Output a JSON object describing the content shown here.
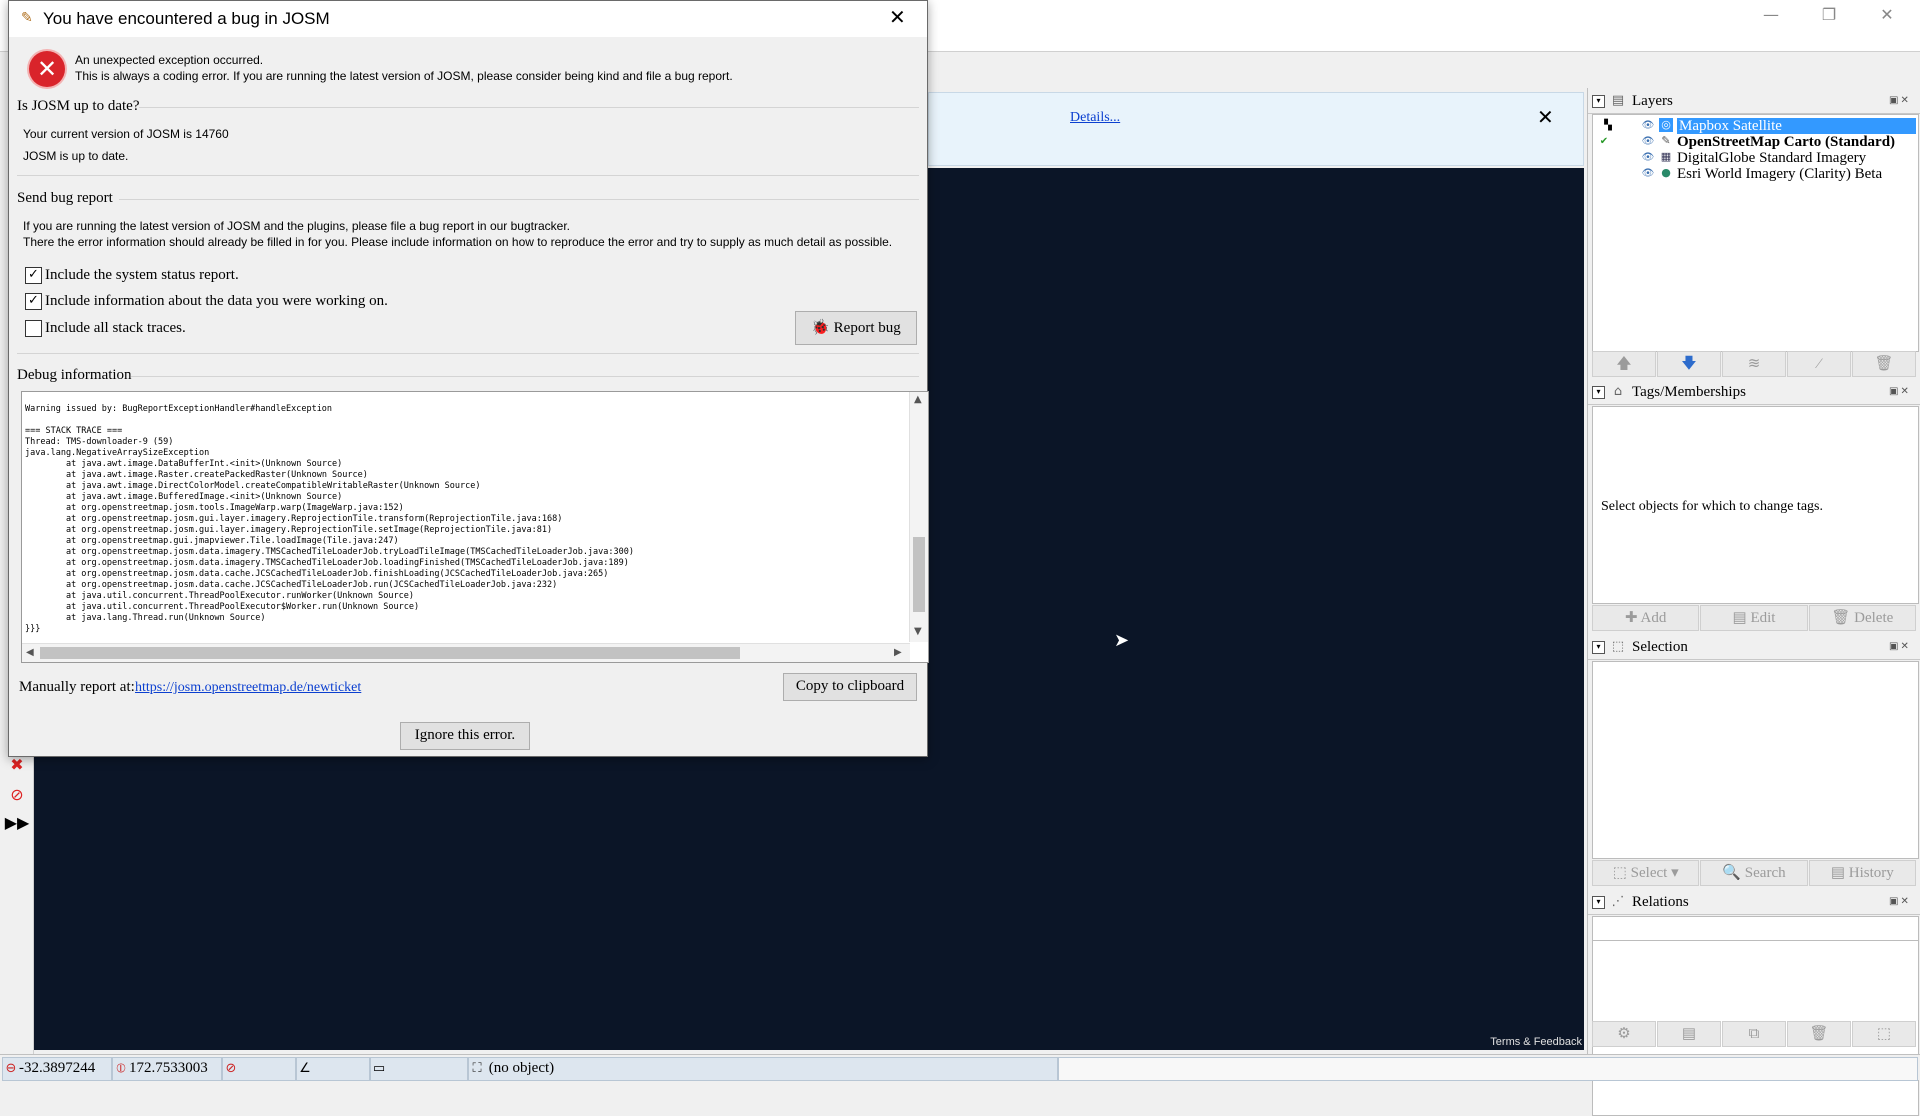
{
  "main_window": {
    "controls": {
      "minimize": "—",
      "restore": "❐",
      "close": "✕"
    },
    "notification": {
      "details_link": "Details...",
      "close": "✕"
    },
    "map_attribution": "Terms & Feedback"
  },
  "dialog": {
    "title": "You have encountered a bug in JOSM",
    "close": "✕",
    "message_line1": "An unexpected exception occurred.",
    "message_line2": "This is always a coding error. If you are running the latest version of JOSM, please consider being kind and file a bug report.",
    "uptodate": {
      "heading": "Is JOSM up to date?",
      "version_text": "Your current version of JOSM is 14760",
      "status_text": "JOSM is up to date."
    },
    "send_report": {
      "heading": "Send bug report",
      "info_line1": "If you are running the latest version of JOSM and the plugins, please file a bug report in our bugtracker.",
      "info_line2": "There the error information should already be filled in for you. Please include information on how to reproduce the error and try to supply as much detail as possible.",
      "checkboxes": [
        {
          "label": "Include the system status report.",
          "checked": true,
          "mark": "✓"
        },
        {
          "label": "Include information about the data you were working on.",
          "checked": true,
          "mark": "✓"
        },
        {
          "label": "Include all stack traces.",
          "checked": false,
          "mark": ""
        }
      ],
      "report_button": "Report bug"
    },
    "debug": {
      "heading": "Debug information",
      "text": "Warning issued by: BugReportExceptionHandler#handleException\n\n=== STACK TRACE ===\nThread: TMS-downloader-9 (59)\njava.lang.NegativeArraySizeException\n\tat java.awt.image.DataBufferInt.<init>(Unknown Source)\n\tat java.awt.image.Raster.createPackedRaster(Unknown Source)\n\tat java.awt.image.DirectColorModel.createCompatibleWritableRaster(Unknown Source)\n\tat java.awt.image.BufferedImage.<init>(Unknown Source)\n\tat org.openstreetmap.josm.tools.ImageWarp.warp(ImageWarp.java:152)\n\tat org.openstreetmap.josm.gui.layer.imagery.ReprojectionTile.transform(ReprojectionTile.java:168)\n\tat org.openstreetmap.josm.gui.layer.imagery.ReprojectionTile.setImage(ReprojectionTile.java:81)\n\tat org.openstreetmap.gui.jmapviewer.Tile.loadImage(Tile.java:247)\n\tat org.openstreetmap.josm.data.imagery.TMSCachedTileLoaderJob.tryLoadTileImage(TMSCachedTileLoaderJob.java:300)\n\tat org.openstreetmap.josm.data.imagery.TMSCachedTileLoaderJob.loadingFinished(TMSCachedTileLoaderJob.java:189)\n\tat org.openstreetmap.josm.data.cache.JCSCachedTileLoaderJob.finishLoading(JCSCachedTileLoaderJob.java:265)\n\tat org.openstreetmap.josm.data.cache.JCSCachedTileLoaderJob.run(JCSCachedTileLoaderJob.java:232)\n\tat java.util.concurrent.ThreadPoolExecutor.runWorker(Unknown Source)\n\tat java.util.concurrent.ThreadPoolExecutor$Worker.run(Unknown Source)\n\tat java.lang.Thread.run(Unknown Source)\n}}}"
    },
    "manual_label": "Manually report at:",
    "manual_link": "https://josm.openstreetmap.de/newticket",
    "copy_button": "Copy to clipboard",
    "ignore_button": "Ignore this error."
  },
  "layers_panel": {
    "title": "Layers",
    "layers": [
      {
        "name": "Mapbox Satellite",
        "selected": true,
        "bold": false
      },
      {
        "name": "OpenStreetMap Carto (Standard)",
        "selected": false,
        "bold": true
      },
      {
        "name": "DigitalGlobe Standard Imagery",
        "selected": false,
        "bold": false
      },
      {
        "name": "Esri World Imagery (Clarity) Beta",
        "selected": false,
        "bold": false
      }
    ]
  },
  "tags_panel": {
    "title": "Tags/Memberships",
    "empty_text": "Select objects for which to change tags.",
    "buttons": {
      "add": "Add",
      "edit": "Edit",
      "delete": "Delete"
    }
  },
  "selection_panel": {
    "title": "Selection",
    "buttons": {
      "select": "Select",
      "search": "Search",
      "history": "History"
    }
  },
  "relations_panel": {
    "title": "Relations"
  },
  "statusbar": {
    "latitude": "-32.3897244",
    "longitude": "172.7533003",
    "object": "(no object)"
  },
  "colors": {
    "map_background": "#0b1527",
    "selection_highlight": "#3399ff",
    "error_red": "#d9242b",
    "link_blue": "#0b3fd0"
  }
}
